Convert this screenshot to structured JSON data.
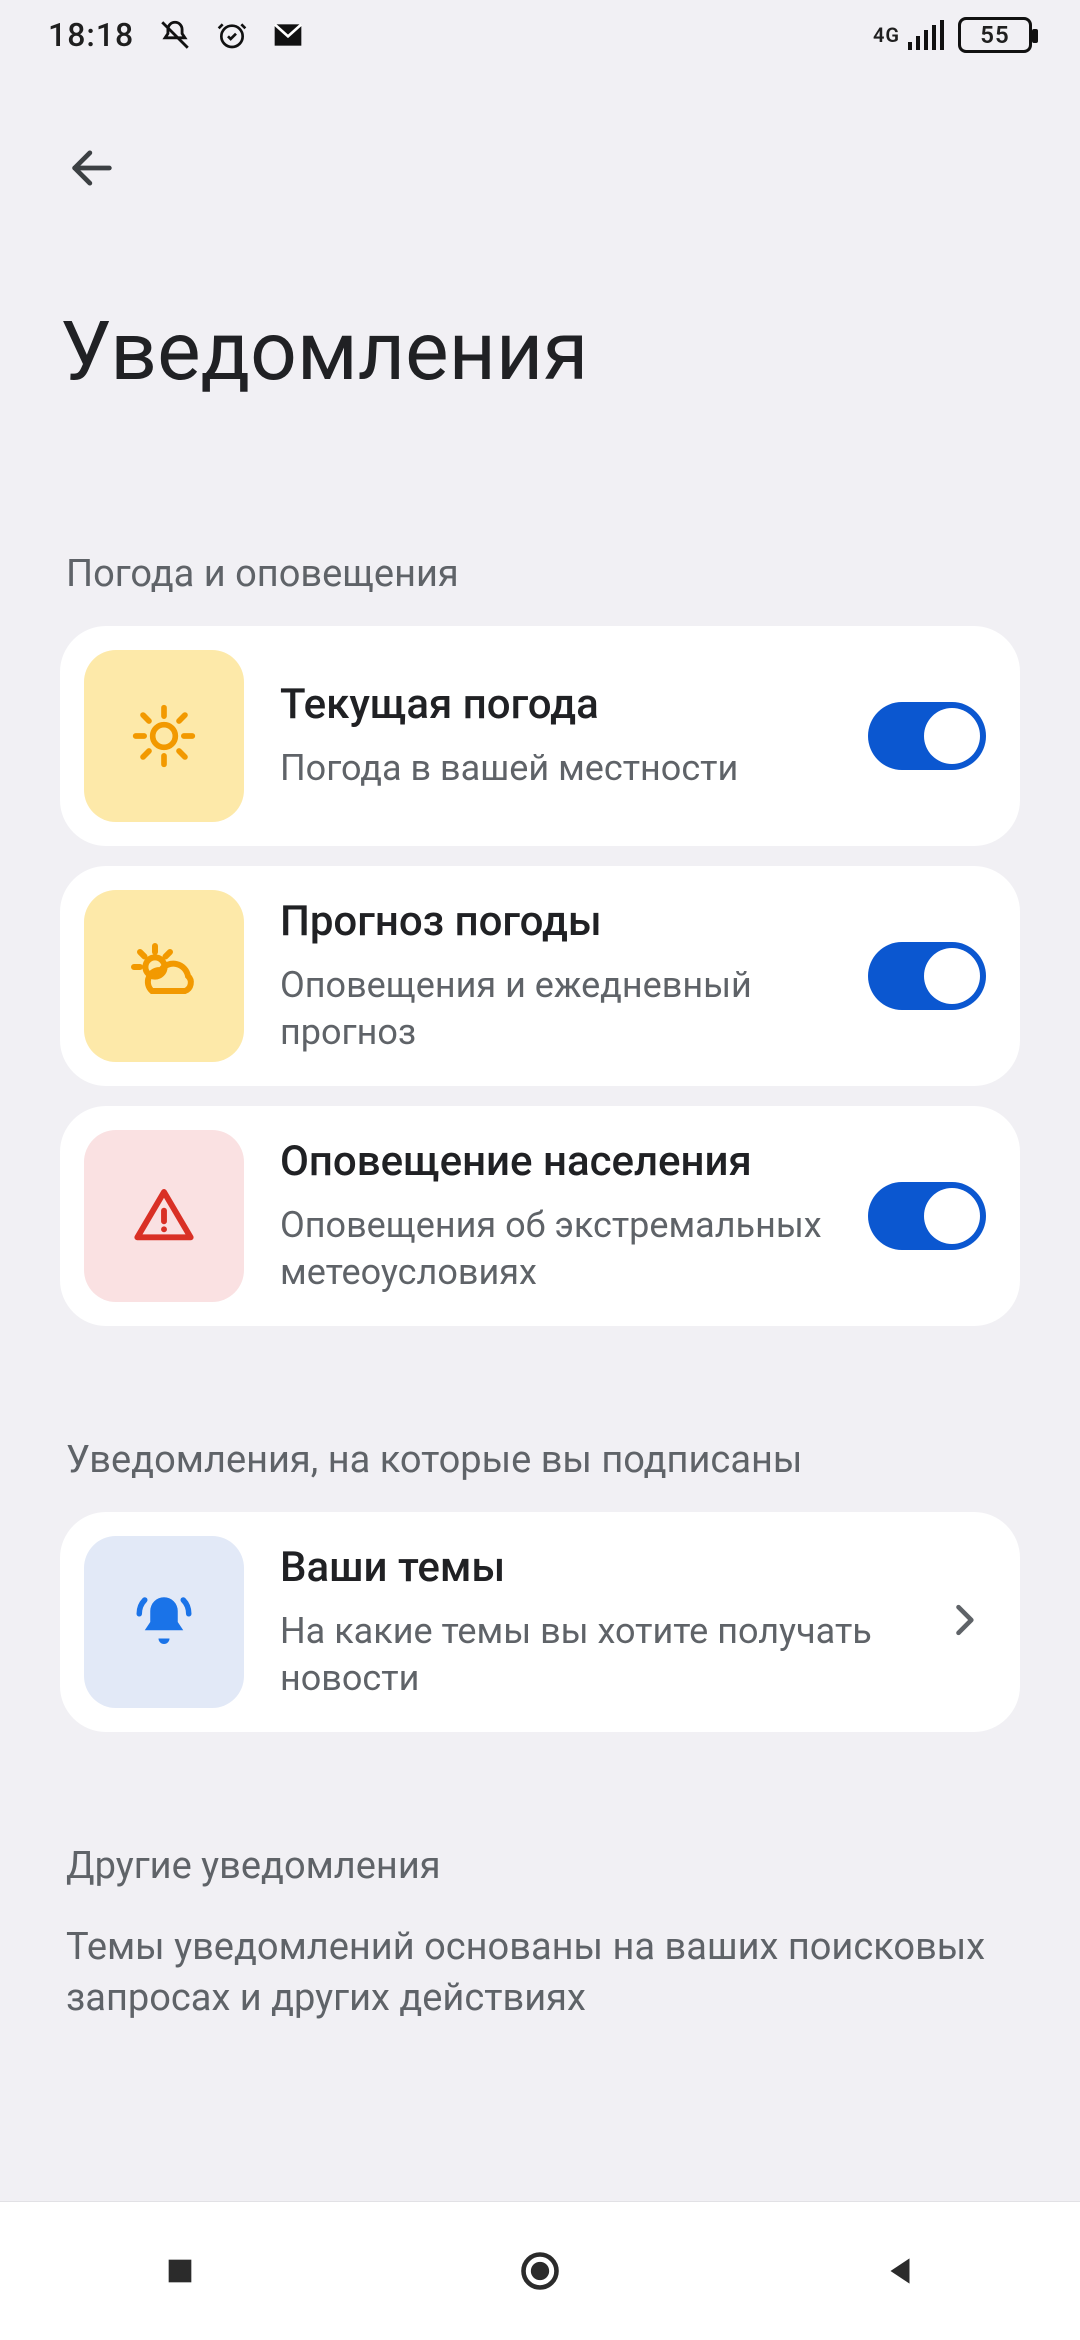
{
  "status": {
    "time": "18:18",
    "battery": "55",
    "network_label": "4G"
  },
  "header": {
    "title": "Уведомления"
  },
  "sections": [
    {
      "title": "Погода и оповещения",
      "items": [
        {
          "title": "Текущая погода",
          "subtitle": "Погода в вашей местности"
        },
        {
          "title": "Прогноз погоды",
          "subtitle": "Оповещения и ежедневный прогноз"
        },
        {
          "title": "Оповещение населения",
          "subtitle": "Оповещения об экстремальных метеоусловиях"
        }
      ]
    },
    {
      "title": "Уведомления, на которые вы подписаны",
      "items": [
        {
          "title": "Ваши темы",
          "subtitle": "На какие темы вы хотите получать новости"
        }
      ]
    },
    {
      "title": "Другие уведомления",
      "description": "Темы уведомлений основаны на ваших поисковых запросах и других действиях"
    }
  ]
}
